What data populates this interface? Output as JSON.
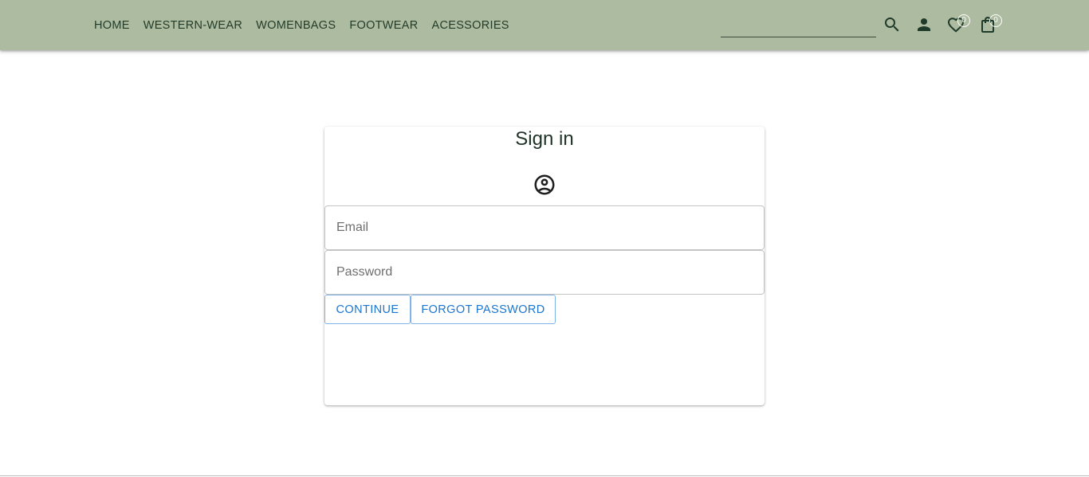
{
  "nav": {
    "links": [
      "HOME",
      "WESTERN-WEAR",
      "WOMENBAGS",
      "FOOTWEAR",
      "ACESSORIES"
    ],
    "search": {
      "value": "",
      "placeholder": ""
    },
    "icons": [
      "search-icon",
      "person-icon",
      "heart-icon",
      "shopping-bag-icon"
    ],
    "wishlist_count": "0",
    "cart_count": "0",
    "bar_color": "#adbba0"
  },
  "signin": {
    "title": "Sign in",
    "icon": "account-circle-icon",
    "email": {
      "placeholder": "Email",
      "value": ""
    },
    "password": {
      "placeholder": "Password",
      "value": ""
    },
    "continue_label": "CONTINUE",
    "forgot_label": "FORGOT PASSWORD",
    "button_color": "#1976d2"
  }
}
